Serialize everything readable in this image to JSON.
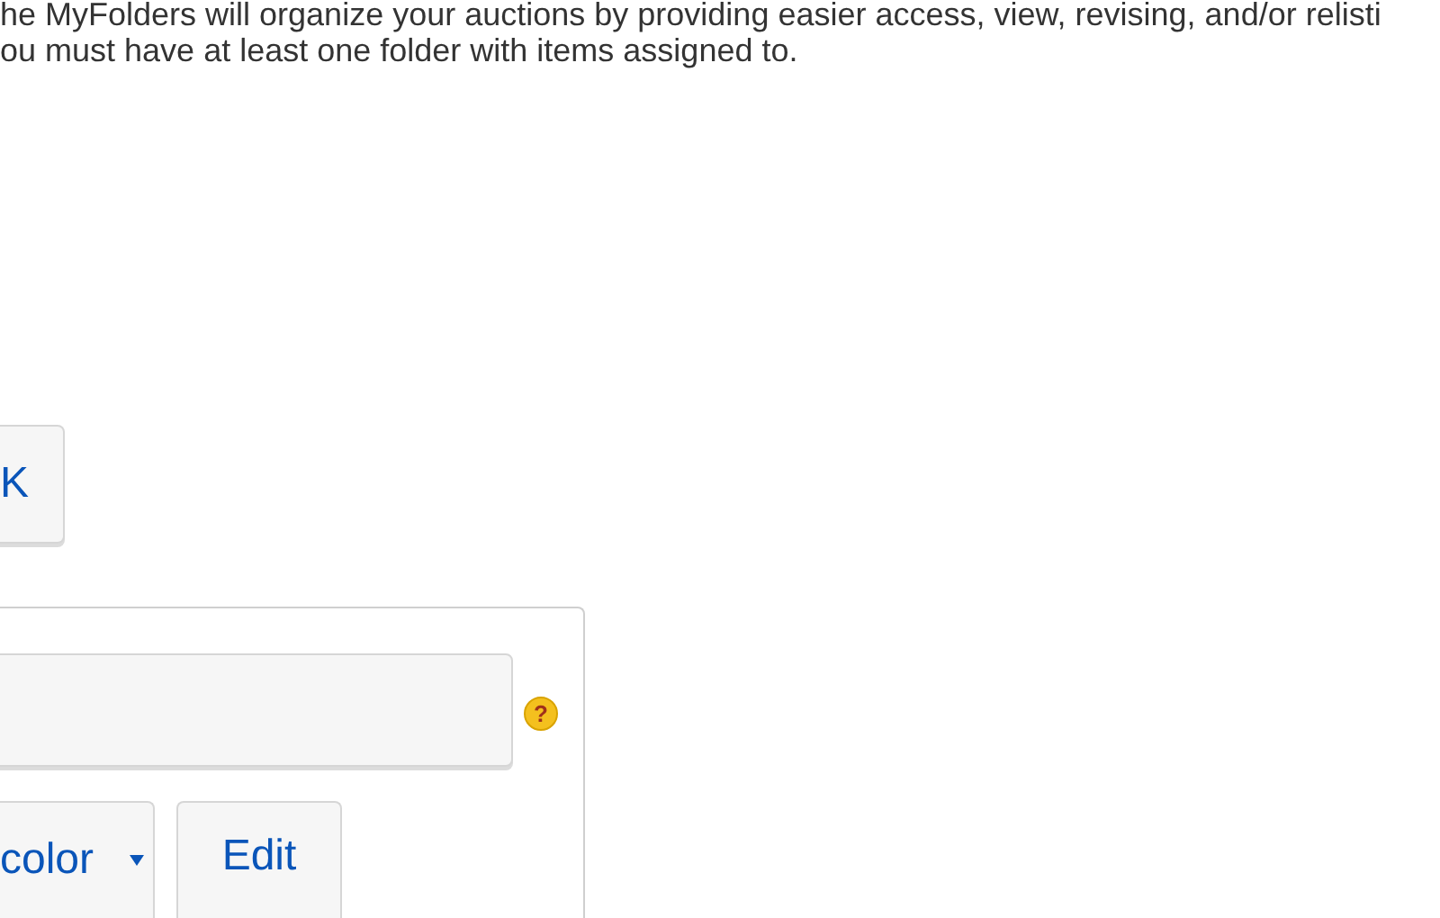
{
  "intro": [
    "he MyFolders will organize your auctions by providing easier access, view, revising, and/or relisti",
    "ou must have at least one folder with items assigned to."
  ],
  "ok_button": {
    "label": "K"
  },
  "folder_panel": {
    "help_icon": {
      "glyph": "?"
    },
    "color_select": {
      "value": "color"
    },
    "edit_button": {
      "label": "Edit"
    }
  }
}
